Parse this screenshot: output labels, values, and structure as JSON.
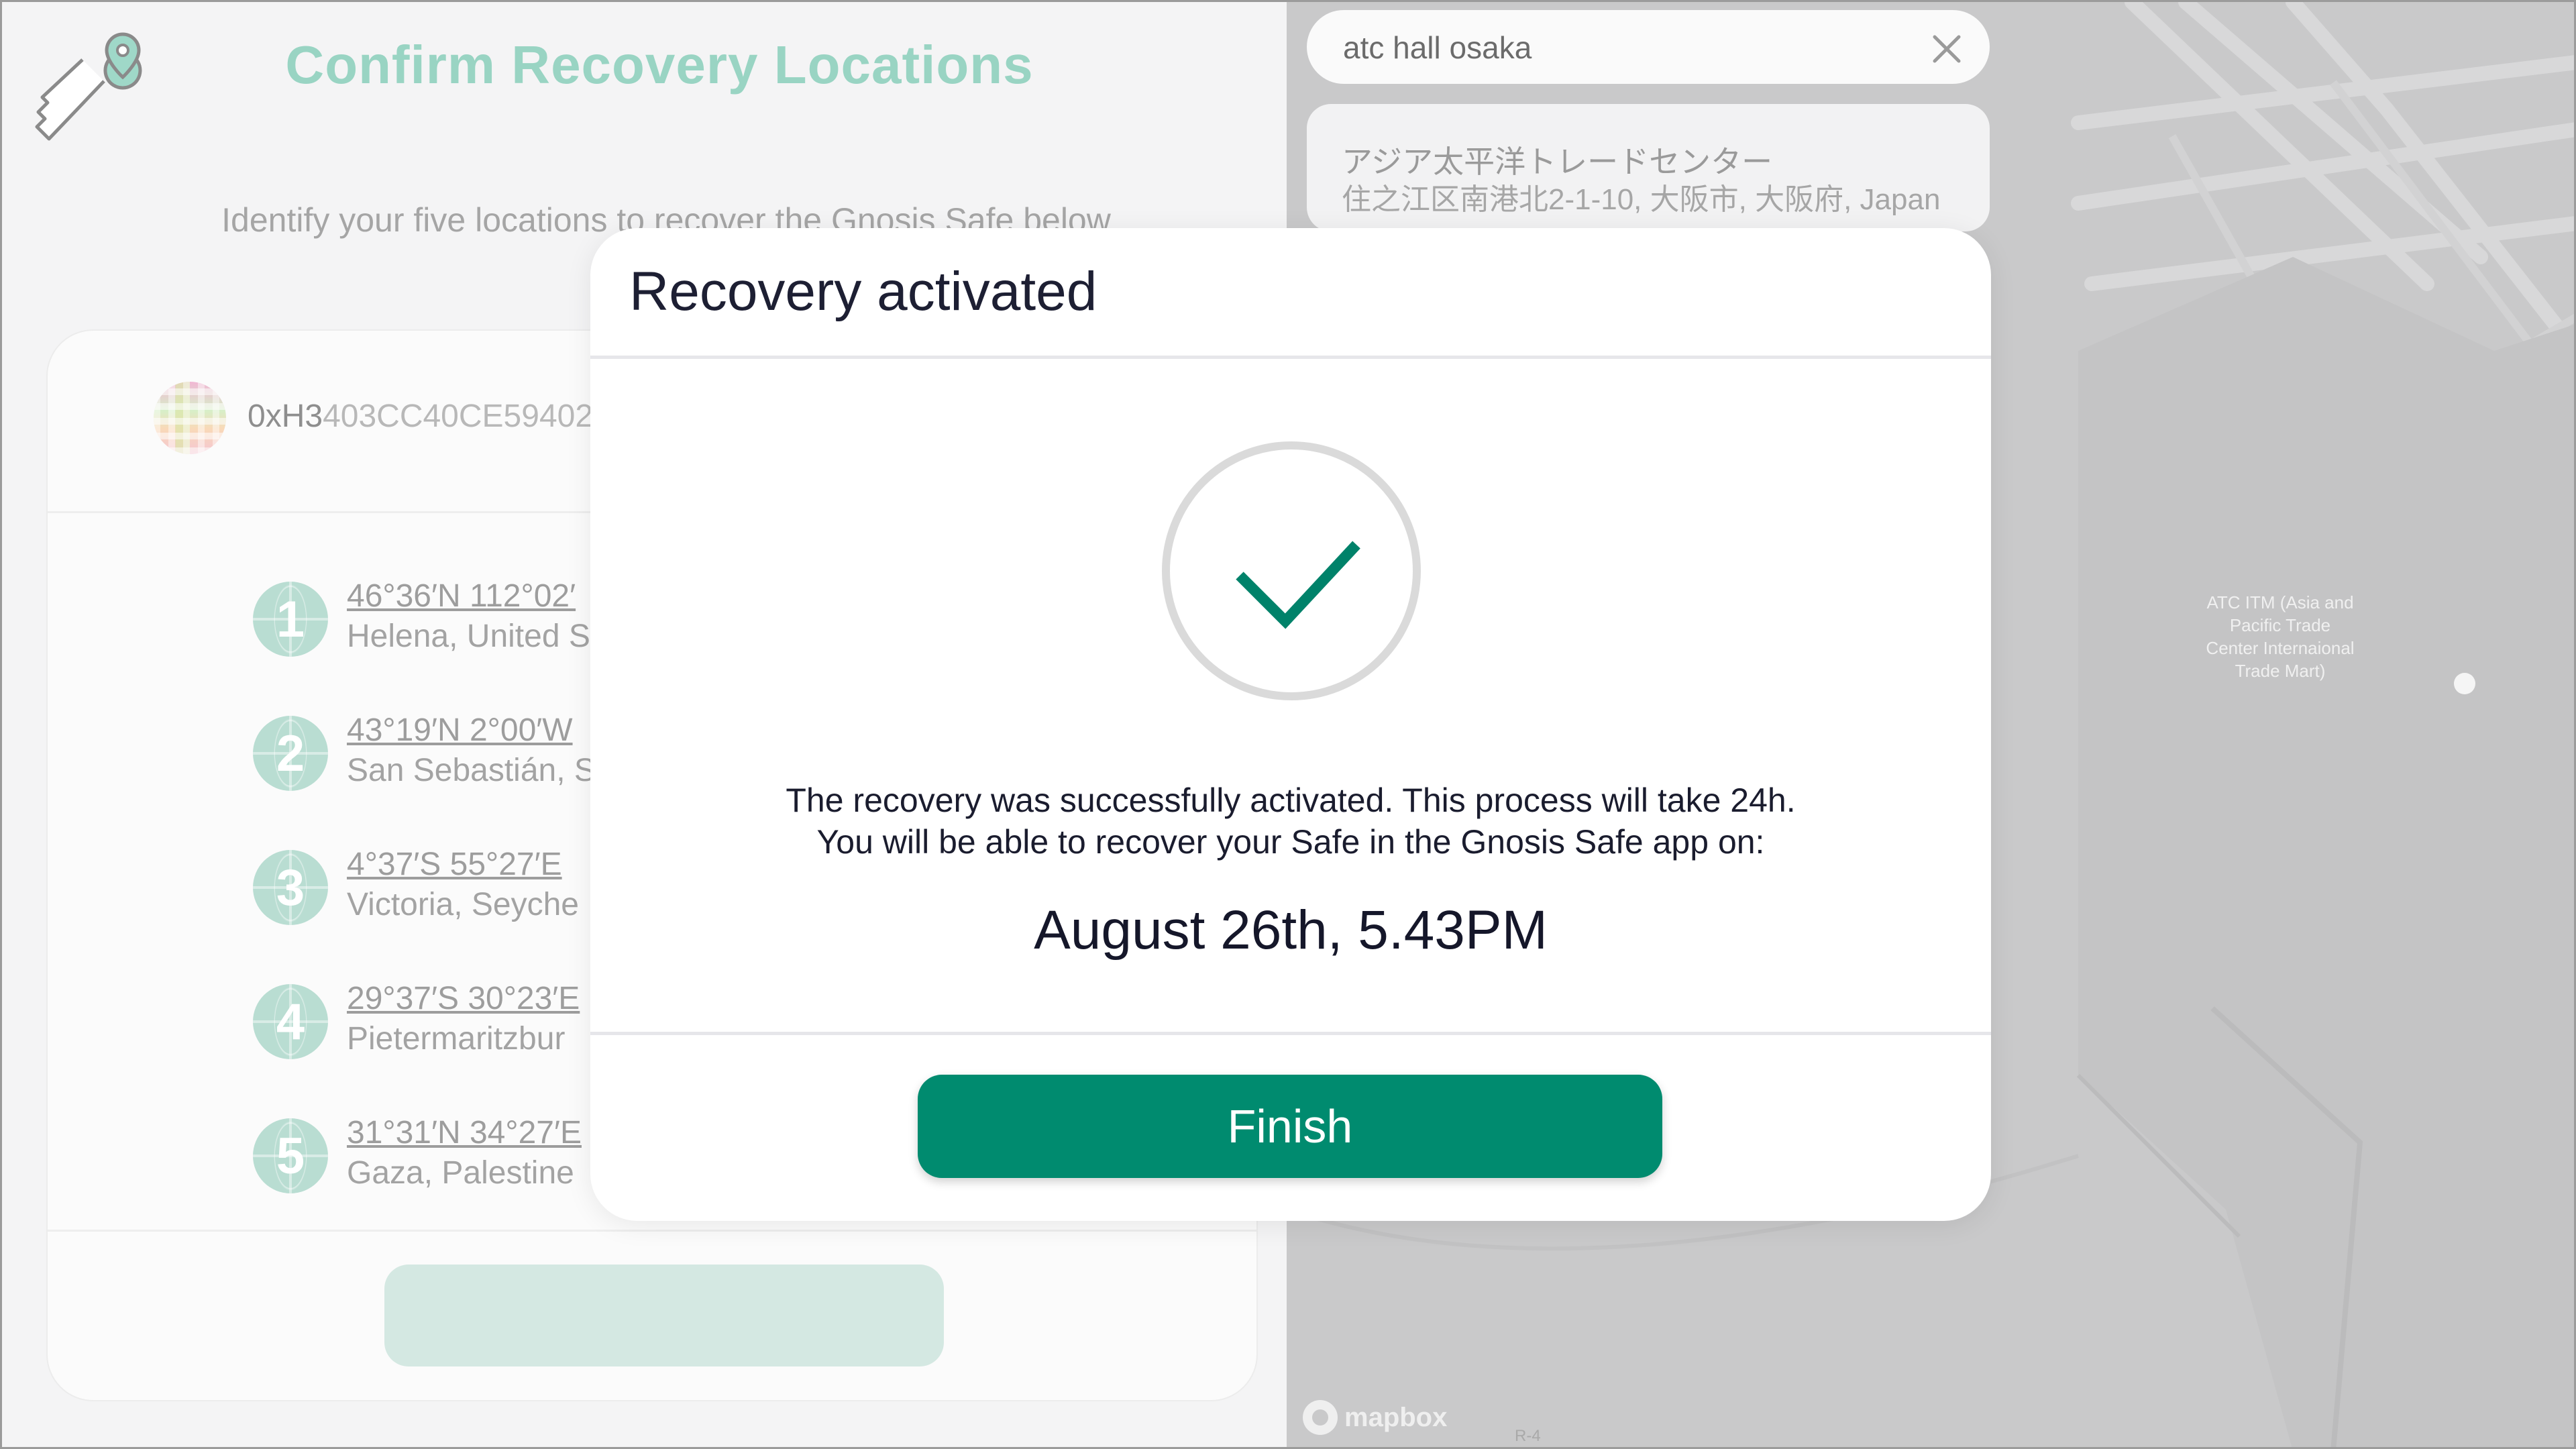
{
  "left_pane": {
    "title": "Confirm Recovery Locations",
    "subtitle": "Identify your five locations to recover the Gnosis Safe below",
    "safe": {
      "address_prefix": "0xH3",
      "address_rest": "403CC40CE59402"
    },
    "locations": [
      {
        "number": "1",
        "coords": "46°36′N 112°02′",
        "city": "Helena, United S"
      },
      {
        "number": "2",
        "coords": "43°19′N 2°00′W",
        "city": "San Sebastián, S"
      },
      {
        "number": "3",
        "coords": "4°37′S 55°27′E",
        "city": "Victoria, Seyche"
      },
      {
        "number": "4",
        "coords": "29°37′S 30°23′E",
        "city": "Pietermaritzbur"
      },
      {
        "number": "5",
        "coords": "31°31′N 34°27′E",
        "city": "Gaza, Palestine"
      }
    ]
  },
  "map": {
    "search": {
      "value": "atc hall osaka"
    },
    "result": {
      "name": "アジア太平洋トレードセンター",
      "address": "住之江区南港北2-1-10, 大阪市, 大阪府, Japan"
    },
    "poi_label": "ATC ITM (Asia and Pacific Trade Center Internaional Trade Mart)",
    "attribution": "mapbox",
    "road_label": "R-4"
  },
  "modal": {
    "title": "Recovery activated",
    "message_line1": "The recovery was successfully activated. This process will take 24h.",
    "message_line2": "You will be able to recover your Safe in the Gnosis Safe app on:",
    "date": "August 26th, 5.43PM",
    "finish_label": "Finish"
  },
  "colors": {
    "accent": "#008b6f",
    "check": "#00826a",
    "title_faded": "#99d4c3",
    "map_bg": "#c9c9ca"
  },
  "icons": [
    "key-location-icon",
    "close-icon",
    "checkmark-icon",
    "mapbox-logo-icon"
  ]
}
